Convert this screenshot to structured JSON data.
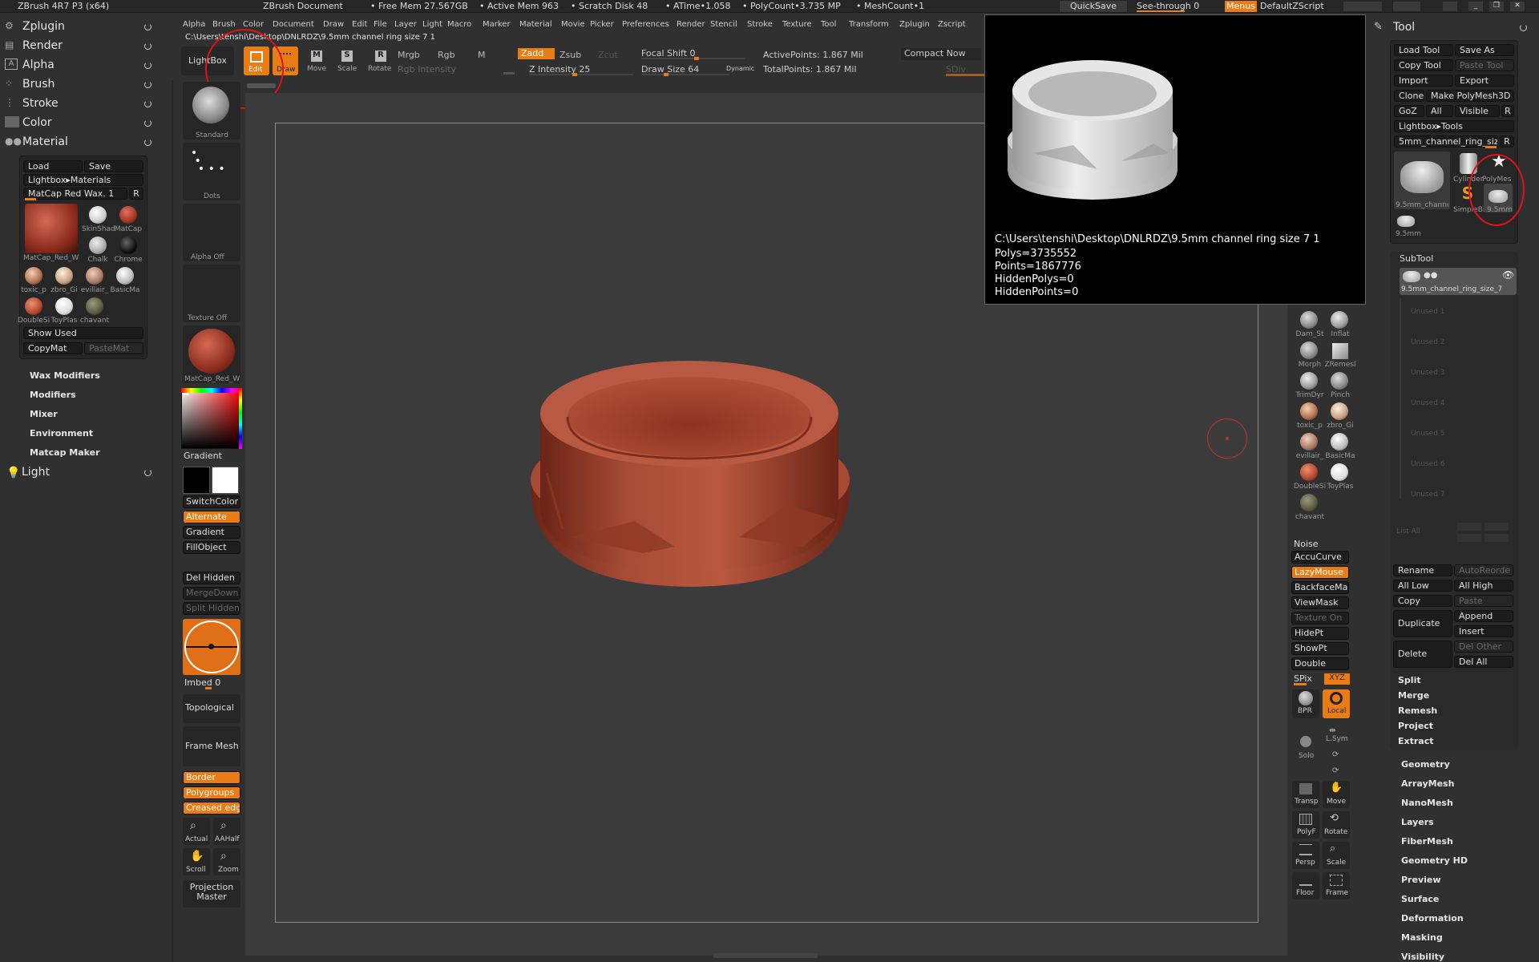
{
  "titlebar": {
    "app": "ZBrush 4R7 P3 (x64)",
    "doc": "ZBrush Document",
    "free_mem": "• Free Mem 27.567GB",
    "active_mem": "• Active Mem 963",
    "scratch": "• Scratch Disk 48",
    "atime": "• ATime•1.058",
    "polycount": "• PolyCount•3.735 MP",
    "meshcount": "• MeshCount•1",
    "quicksave": "QuickSave",
    "seethrough": "See-through  0",
    "menus": "Menus",
    "script": "DefaultZScript"
  },
  "menubar": [
    "Alpha",
    "Brush",
    "Color",
    "Document",
    "Draw",
    "Edit",
    "File",
    "Layer",
    "Light",
    "Macro",
    "Marker",
    "Material",
    "Movie",
    "Picker",
    "Preferences",
    "Render",
    "Stencil",
    "Stroke",
    "Texture",
    "Tool",
    "Transform",
    "Zplugin",
    "Zscript"
  ],
  "filepath": "C:\\Users\\tenshi\\Desktop\\DNLRDZ\\9.5mm channel ring size 7 1",
  "toolbar": {
    "lightbox": "LightBox",
    "edit": "Edit",
    "draw": "Draw",
    "move": "Move",
    "scale": "Scale",
    "rotate": "Rotate",
    "mrgb": "Mrgb",
    "rgb": "Rgb",
    "m": "M",
    "rgb_intensity": "Rgb Intensity",
    "zadd": "Zadd",
    "zsub": "Zsub",
    "zcut": "Zcut",
    "z_intensity": "Z Intensity 25",
    "focal_shift": "Focal Shift 0",
    "draw_size": "Draw Size 64",
    "dynamic": "Dynamic",
    "active_points": "ActivePoints: 1.867  Mil",
    "total_points": "TotalPoints: 1.867  Mil",
    "compact": "Compact Now",
    "sdiv": "SDiv"
  },
  "left_menu": {
    "items": [
      "Zplugin",
      "Render",
      "Alpha",
      "Brush",
      "Stroke",
      "Color",
      "Material"
    ],
    "light": "Light"
  },
  "material": {
    "load": "Load",
    "save": "Save",
    "lightbox": "Lightbox▸Materials",
    "current": "MatCap Red Wax. 1",
    "r": "R",
    "big_label": "MatCap_Red_W",
    "swatches": [
      {
        "name": "SkinShad",
        "color": "#f2f2f2"
      },
      {
        "name": "MatCap",
        "color": "#b84a30"
      },
      {
        "name": "Chalk",
        "color": "#d8d8d8"
      },
      {
        "name": "Chrome",
        "color": "#1a1a1a"
      },
      {
        "name": "toxic_p",
        "color": "#d6a27a"
      },
      {
        "name": "zbro_Gi",
        "color": "#e8c8b0"
      },
      {
        "name": "evillair_",
        "color": "#c89a80"
      },
      {
        "name": "BasicMa",
        "color": "#e0e0e0"
      },
      {
        "name": "DoubleSi",
        "color": "#c06040"
      },
      {
        "name": "ToyPlas",
        "color": "#f0f0f0"
      },
      {
        "name": "chavant",
        "color": "#6a6a50"
      }
    ],
    "show_used": "Show Used",
    "copymat": "CopyMat",
    "pastemat": "PasteMat",
    "submenus": [
      "Wax Modifiers",
      "Modifiers",
      "Mixer",
      "Environment",
      "Matcap Maker"
    ]
  },
  "shelf": {
    "standard": "Standard",
    "dots": "Dots",
    "alpha_off": "Alpha  Off",
    "texture_off": "Texture  Off",
    "matcap": "MatCap_Red_W",
    "gradient": "Gradient",
    "switchcolor": "SwitchColor",
    "alternate": "Alternate",
    "gradient2": "Gradient",
    "fillobject": "FillObject",
    "del_hidden": "Del Hidden",
    "mergedown": "MergeDown",
    "split_hidden": "Split  Hidden",
    "imbed": "Imbed 0",
    "topological": "Topological",
    "frame_mesh": "Frame Mesh",
    "border": "Border",
    "polygroups": "Polygroups",
    "creased": "Creased edg",
    "actual": "Actual",
    "aahalf": "AAHalf",
    "scroll": "Scroll",
    "zoom": "Zoom",
    "projection": "Projection Master"
  },
  "popup": {
    "path": "C:\\Users\\tenshi\\Desktop\\DNLRDZ\\9.5mm channel ring size 7 1",
    "polys": "Polys=3735552",
    "points": "Points=1867776",
    "hidden_polys": "HiddenPolys=0",
    "hidden_points": "HiddenPoints=0"
  },
  "right_shelf": {
    "brushes": [
      "Dam_St",
      "Inflat",
      "Morph",
      "ZRemesl",
      "TrimDyr",
      "Pinch",
      "toxic_p",
      "zbro_Gi",
      "evillair_",
      "BasicMa",
      "DoubleSi",
      "ToyPlas",
      "chavant"
    ],
    "noise": "Noise",
    "accucurve": "AccuCurve",
    "lazymouse": "LazyMouse",
    "backfacemask": "BackfaceMa:",
    "viewmask": "ViewMask",
    "texture_on": "Texture On",
    "hidept": "HidePt",
    "showpt": "ShowPt",
    "double": "Double",
    "spix": "SPix",
    "xyz": "XYZ",
    "bpr": "BPR",
    "local": "Local",
    "solo": "Solo",
    "lsym": "L.Sym",
    "transp": "Transp",
    "move": "Move",
    "polyf": "PolyF",
    "rotate": "Rotate",
    "persp": "Persp",
    "scale": "Scale",
    "floor": "Floor",
    "frame": "Frame"
  },
  "tool": {
    "title": "Tool",
    "load": "Load Tool",
    "saveas": "Save As",
    "copy": "Copy Tool",
    "paste": "Paste Tool",
    "import": "Import",
    "export": "Export",
    "clone": "Clone",
    "makepoly": "Make PolyMesh3D",
    "goz": "GoZ",
    "all": "All",
    "visible": "Visible",
    "r": "R",
    "lightbox": "Lightbox▸Tools",
    "current": "5mm_channel_ring_siz",
    "r2": "R",
    "thumbs": [
      "9.5mm_channel",
      "Cylinder",
      "PolyMes",
      "SimpleBi",
      "9.5mm",
      "9.5mm"
    ],
    "subtool": "SubTool",
    "subtool_name": "9.5mm_channel_ring_size_7",
    "unused": [
      "Unused 1",
      "Unused 2",
      "Unused 3",
      "Unused 4",
      "Unused 5",
      "Unused 6",
      "Unused 7"
    ],
    "listall": "List All",
    "rename": "Rename",
    "autoreorder": "AutoReorde",
    "alllow": "All Low",
    "allhigh": "All High",
    "copy2": "Copy",
    "paste2": "Paste",
    "duplicate": "Duplicate",
    "append": "Append",
    "insert": "Insert",
    "delete": "Delete",
    "delother": "Del Other",
    "delall": "Del All",
    "actions": [
      "Split",
      "Merge",
      "Remesh",
      "Project",
      "Extract"
    ],
    "sections": [
      "Geometry",
      "ArrayMesh",
      "NanoMesh",
      "Layers",
      "FiberMesh",
      "Geometry HD",
      "Preview",
      "Surface",
      "Deformation",
      "Masking",
      "Visibility"
    ]
  }
}
